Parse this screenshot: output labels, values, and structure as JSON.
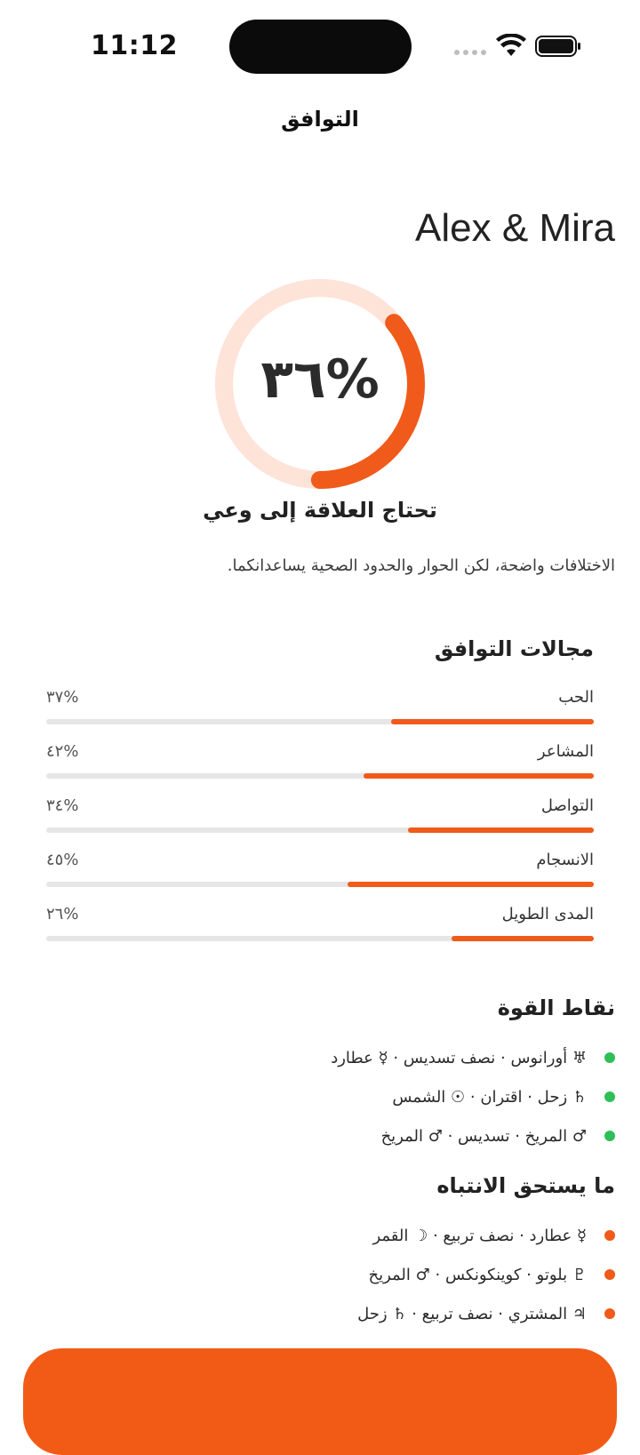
{
  "status": {
    "time": "11:12"
  },
  "nav": {
    "title": "التوافق"
  },
  "couple": {
    "names": "Alex & Mira"
  },
  "score": {
    "value": 36,
    "label": "٣٦%",
    "verdict": "تحتاج العلاقة إلى وعي",
    "summary": "الاختلافات واضحة، لكن الحوار والحدود الصحية يساعدانكما.",
    "ring_color": "#f05a1a",
    "ring_track_color": "#fde3d8"
  },
  "areas": {
    "title": "مجالات التوافق",
    "items": [
      {
        "label": "الحب",
        "value": 37,
        "value_label": "٣٧%"
      },
      {
        "label": "المشاعر",
        "value": 42,
        "value_label": "٤٢%"
      },
      {
        "label": "التواصل",
        "value": 34,
        "value_label": "٣٤%"
      },
      {
        "label": "الانسجام",
        "value": 45,
        "value_label": "٤٥%"
      },
      {
        "label": "المدى الطويل",
        "value": 26,
        "value_label": "٢٦%"
      }
    ]
  },
  "strengths": {
    "title": "نقاط القوة",
    "dot_color": "#2fbf58",
    "items": [
      {
        "text": "♅ أورانوس · نصف تسديس · ☿ عطارد"
      },
      {
        "text": "♄ زحل · اقتران · ☉ الشمس"
      },
      {
        "text": "♂ المريخ · تسديس · ♂ المريخ"
      }
    ]
  },
  "attention": {
    "title": "ما يستحق الانتباه",
    "dot_color": "#f05a1a",
    "items": [
      {
        "text": "☿ عطارد · نصف تربيع · ☽ القمر"
      },
      {
        "text": "♇ بلوتو · كوينكونكس · ♂ المريخ"
      },
      {
        "text": "♃ المشتري · نصف تربيع · ♄ زحل"
      }
    ]
  },
  "cta": {
    "label": ""
  }
}
